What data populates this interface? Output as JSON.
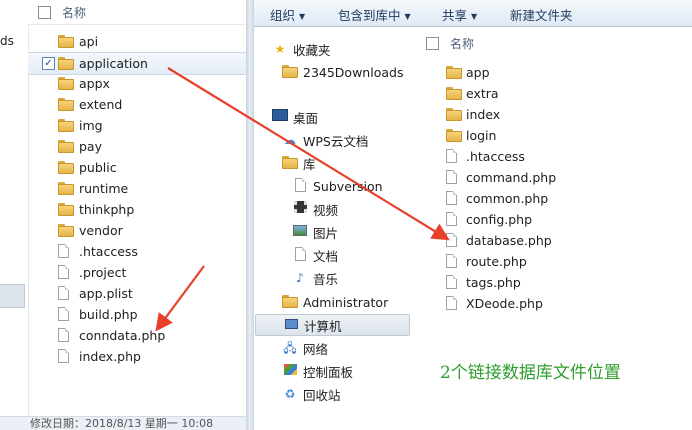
{
  "left": {
    "nav_fragment": "ds",
    "header_name": "名称",
    "items": [
      {
        "name": "api",
        "type": "folder"
      },
      {
        "name": "application",
        "type": "folder",
        "selected": true
      },
      {
        "name": "appx",
        "type": "folder"
      },
      {
        "name": "extend",
        "type": "folder"
      },
      {
        "name": "img",
        "type": "folder"
      },
      {
        "name": "pay",
        "type": "folder"
      },
      {
        "name": "public",
        "type": "folder"
      },
      {
        "name": "runtime",
        "type": "folder"
      },
      {
        "name": "thinkphp",
        "type": "folder"
      },
      {
        "name": "vendor",
        "type": "folder"
      },
      {
        "name": ".htaccess",
        "type": "file"
      },
      {
        "name": ".project",
        "type": "file"
      },
      {
        "name": "app.plist",
        "type": "file"
      },
      {
        "name": "build.php",
        "type": "file"
      },
      {
        "name": "conndata.php",
        "type": "file"
      },
      {
        "name": "index.php",
        "type": "file"
      }
    ],
    "status_text": "修改日期：2018/8/13 星期一 10:08"
  },
  "toolbar": {
    "organize": "组织",
    "include_library": "包含到库中",
    "share": "共享",
    "new_folder": "新建文件夹"
  },
  "nav": {
    "favorites": "收藏夹",
    "downloads": "2345Downloads",
    "desktop": "桌面",
    "wps": "WPS云文档",
    "library": "库",
    "subversion": "Subversion",
    "videos": "视频",
    "pictures": "图片",
    "documents": "文档",
    "music": "音乐",
    "administrator": "Administrator",
    "computer": "计算机",
    "network": "网络",
    "control_panel": "控制面板",
    "recycle_bin": "回收站"
  },
  "right": {
    "header_name": "名称",
    "items": [
      {
        "name": "app",
        "type": "folder"
      },
      {
        "name": "extra",
        "type": "folder"
      },
      {
        "name": "index",
        "type": "folder"
      },
      {
        "name": "login",
        "type": "folder"
      },
      {
        "name": ".htaccess",
        "type": "file"
      },
      {
        "name": "command.php",
        "type": "file"
      },
      {
        "name": "common.php",
        "type": "file"
      },
      {
        "name": "config.php",
        "type": "file"
      },
      {
        "name": "database.php",
        "type": "file"
      },
      {
        "name": "route.php",
        "type": "file"
      },
      {
        "name": "tags.php",
        "type": "file"
      },
      {
        "name": "XDeode.php",
        "type": "file"
      }
    ]
  },
  "annotation": "2个链接数据库文件位置",
  "colors": {
    "arrow": "#e8402a",
    "annotation": "#2e9e2e"
  }
}
